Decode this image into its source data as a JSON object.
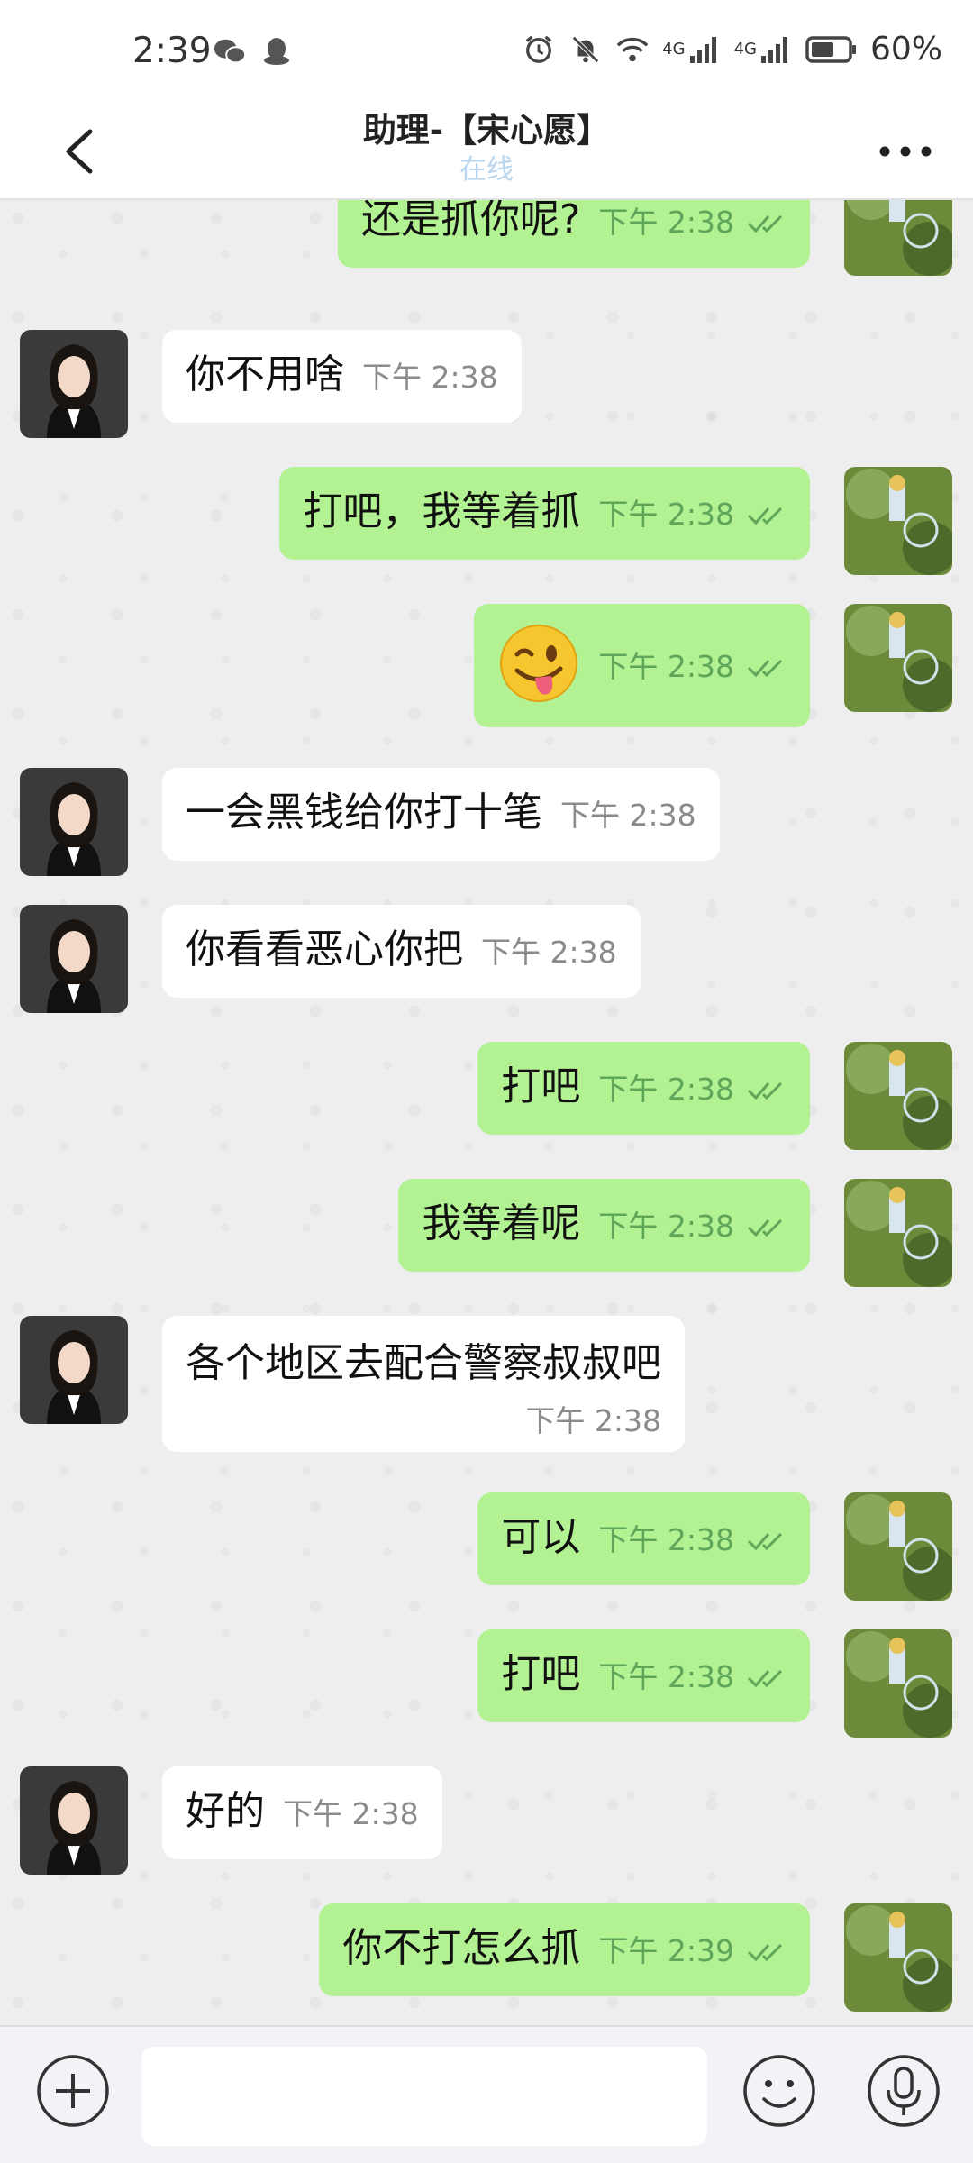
{
  "status_bar": {
    "time": "2:39",
    "network_1": "4G",
    "network_2": "4G",
    "battery": "60%",
    "left_icons": [
      "wechat-icon",
      "qq-icon"
    ],
    "right_icons": [
      "alarm-icon",
      "mute-icon",
      "wifi-icon",
      "signal-icon",
      "signal-icon",
      "battery-icon"
    ]
  },
  "header": {
    "title": "助理-【宋心愿】",
    "subtitle": "在线"
  },
  "messages": [
    {
      "dir": "out",
      "text": "还是抓你呢?",
      "time": "下午  2:38"
    },
    {
      "dir": "in",
      "text": "你不用啥",
      "time": "下午  2:38"
    },
    {
      "dir": "out",
      "text": "打吧，我等着抓",
      "time": "下午  2:38"
    },
    {
      "dir": "out",
      "text": "",
      "emoji": "winking-face-with-tongue",
      "time": "下午  2:38"
    },
    {
      "dir": "in",
      "text": "一会黑钱给你打十笔",
      "time": "下午  2:38"
    },
    {
      "dir": "in",
      "text": "你看看恶心你把",
      "time": "下午  2:38"
    },
    {
      "dir": "out",
      "text": "打吧",
      "time": "下午  2:38"
    },
    {
      "dir": "out",
      "text": "我等着呢",
      "time": "下午  2:38"
    },
    {
      "dir": "in",
      "text": "各个地区去配合警察叔叔吧",
      "time": "下午  2:38"
    },
    {
      "dir": "out",
      "text": "可以",
      "time": "下午  2:38"
    },
    {
      "dir": "out",
      "text": "打吧",
      "time": "下午  2:38"
    },
    {
      "dir": "in",
      "text": "好的",
      "time": "下午  2:38"
    },
    {
      "dir": "out",
      "text": "你不打怎么抓",
      "time": "下午  2:39"
    }
  ],
  "input_bar": {
    "placeholder": "",
    "value": ""
  },
  "colors": {
    "outgoing_bubble": "#b3f293",
    "incoming_bubble": "#ffffff",
    "timestamp_out": "#5fa55a",
    "online_status": "#b9d6ee"
  }
}
